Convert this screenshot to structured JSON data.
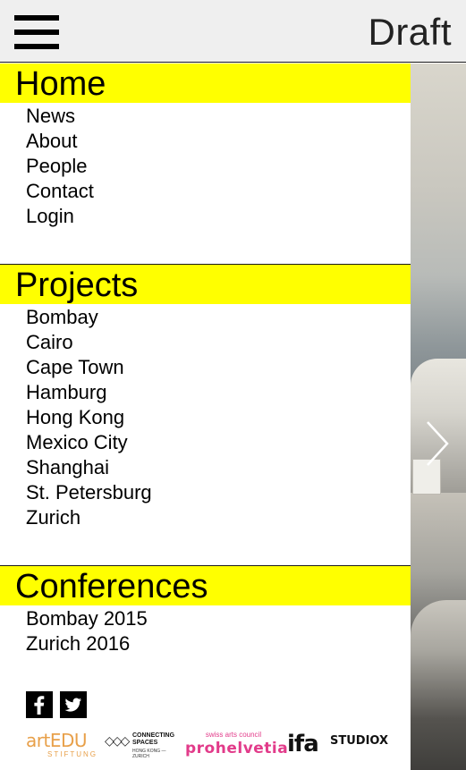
{
  "header": {
    "brand": "Draft"
  },
  "menu": {
    "sections": [
      {
        "title": "Home",
        "items": [
          "News",
          "About",
          "People",
          "Contact",
          "Login"
        ]
      },
      {
        "title": "Projects",
        "items": [
          "Bombay",
          "Cairo",
          "Cape Town",
          "Hamburg",
          "Hong Kong",
          "Mexico City",
          "Shanghai",
          "St. Petersburg",
          "Zurich"
        ]
      },
      {
        "title": "Conferences",
        "items": [
          "Bombay 2015",
          "Zurich 2016"
        ]
      }
    ]
  },
  "social": {
    "facebook_glyph": "f",
    "twitter_glyph": "t"
  },
  "logos": {
    "artedu_main": "artEDU",
    "artedu_sub": "STIFTUNG",
    "connecting_spaces": "CONNECTING SPACES",
    "connecting_spaces_sub": "HONG KONG — ZURICH",
    "prohelvetia_top": "swiss arts council",
    "prohelvetia_main": "prohelvetia",
    "ifa": "ifa",
    "studio": "STUDIOX"
  },
  "icons": {
    "menu": "hamburger-icon",
    "next": "chevron-right-icon",
    "facebook": "facebook-icon",
    "twitter": "twitter-icon"
  },
  "colors": {
    "highlight": "#ffff00",
    "topbar": "#efefef",
    "artedu": "#e8a04a",
    "prohelvetia": "#e23b8a",
    "ifa_red": "#e8192c"
  }
}
